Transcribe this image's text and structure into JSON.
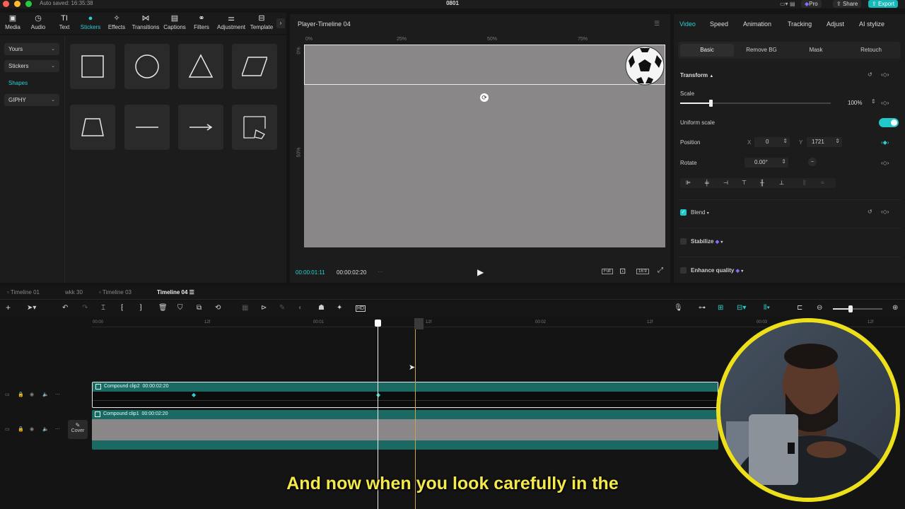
{
  "titlebar": {
    "autosave": "Auto saved: 16:35:38",
    "project": "0801",
    "pro_label": "Pro",
    "share_label": "Share",
    "export_label": "Export"
  },
  "media_tools": [
    {
      "label": "Media",
      "icon": "media-icon"
    },
    {
      "label": "Audio",
      "icon": "audio-icon"
    },
    {
      "label": "Text",
      "icon": "text-icon"
    },
    {
      "label": "Stickers",
      "icon": "stickers-icon"
    },
    {
      "label": "Effects",
      "icon": "effects-icon"
    },
    {
      "label": "Transitions",
      "icon": "transitions-icon"
    },
    {
      "label": "Captions",
      "icon": "captions-icon"
    },
    {
      "label": "Filters",
      "icon": "filters-icon"
    },
    {
      "label": "Adjustment",
      "icon": "adjustment-icon"
    },
    {
      "label": "Template",
      "icon": "template-icon"
    }
  ],
  "side_nav": [
    {
      "label": "Yours"
    },
    {
      "label": "Stickers"
    },
    {
      "label": "Shapes"
    },
    {
      "label": "GIPHY"
    }
  ],
  "player": {
    "title": "Player-Timeline 04",
    "ruler": [
      "0%",
      "25%",
      "50%",
      "75%"
    ],
    "ruler_v": [
      "0%",
      "50%"
    ],
    "current_time": "00:00:01:11",
    "total_time": "00:00:02:20",
    "full_label": "Full",
    "ratio_label": "16:9"
  },
  "inspector": {
    "tabs": [
      "Video",
      "Speed",
      "Animation",
      "Tracking",
      "Adjust",
      "AI stylize"
    ],
    "subtabs": [
      "Basic",
      "Remove BG",
      "Mask",
      "Retouch"
    ],
    "transform_label": "Transform",
    "scale_label": "Scale",
    "scale_value": "100%",
    "uniform_label": "Uniform scale",
    "position_label": "Position",
    "x_label": "X",
    "x_value": "0",
    "y_label": "Y",
    "y_value": "1721",
    "rotate_label": "Rotate",
    "rotate_value": "0.00°",
    "blend_label": "Blend",
    "stabilize_label": "Stabilize",
    "enhance_label": "Enhance quality"
  },
  "timeline_tabs": [
    "Timeline 01",
    "wkk 30",
    "Timeline 03",
    "Timeline 04"
  ],
  "ruler": [
    "00:00",
    "12f",
    "00:01",
    "12f",
    "00:02",
    "12f",
    "00:03",
    "12f"
  ],
  "clips": [
    {
      "name": "Compound clip2",
      "duration": "00:00:02:20"
    },
    {
      "name": "Compound clip1",
      "duration": "00:00:02:20"
    }
  ],
  "cover_label": "Cover",
  "subtitle": "And now when you look carefully in the",
  "colors": {
    "accent": "#2ad1d1",
    "clip": "#1a6a63",
    "subtitle": "#f4e94a",
    "webcam_ring": "#ede01a"
  }
}
